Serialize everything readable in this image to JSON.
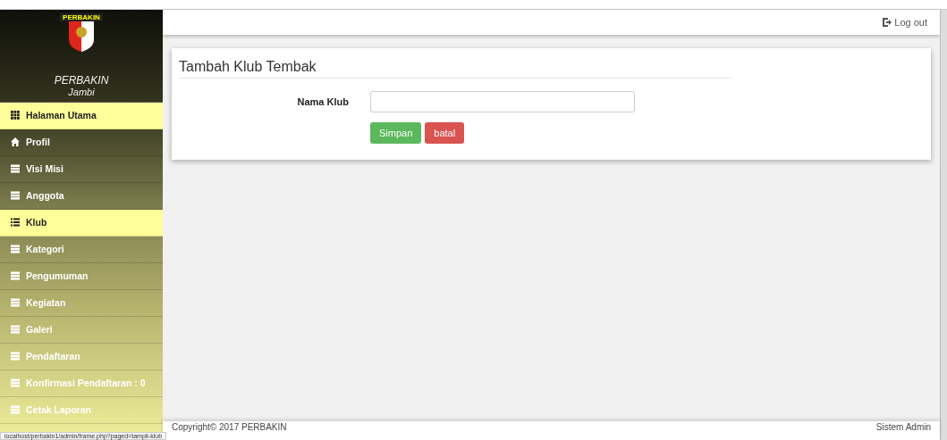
{
  "sidebar": {
    "logo_text": "PERBAKIN",
    "title": "PERBAKIN",
    "subtitle": "Jambi",
    "items": [
      {
        "label": "Halaman Utama",
        "kind": "grid",
        "selected": true
      },
      {
        "label": "Profil",
        "kind": "home",
        "selected": false
      },
      {
        "label": "Visi Misi",
        "kind": "table",
        "selected": false
      },
      {
        "label": "Anggota",
        "kind": "table",
        "selected": false
      },
      {
        "label": "Klub",
        "kind": "list",
        "selected": true
      },
      {
        "label": "Kategori",
        "kind": "table",
        "selected": false
      },
      {
        "label": "Pengumuman",
        "kind": "table",
        "selected": false
      },
      {
        "label": "Kegiatan",
        "kind": "table",
        "selected": false
      },
      {
        "label": "Galeri",
        "kind": "table",
        "selected": false
      },
      {
        "label": "Pendaftaran",
        "kind": "table",
        "selected": false
      },
      {
        "label": "Konfirmasi Pendaftaran : 0",
        "kind": "table",
        "selected": false
      },
      {
        "label": "Cetak Laporan",
        "kind": "table",
        "selected": false
      }
    ]
  },
  "header": {
    "logout": "Log out"
  },
  "form": {
    "title": "Tambah Klub Tembak",
    "field_label": "Nama Klub",
    "buttons": [
      {
        "label": "Simpan",
        "kind": "success"
      },
      {
        "label": "batal",
        "kind": "danger"
      }
    ]
  },
  "footer": {
    "copyright": "Copyright© 2017 PERBAKIN",
    "user": "Sistem Admin"
  },
  "status_url": "localhost/perbakin1/admin/frame.php?paged=tampil-klub"
}
